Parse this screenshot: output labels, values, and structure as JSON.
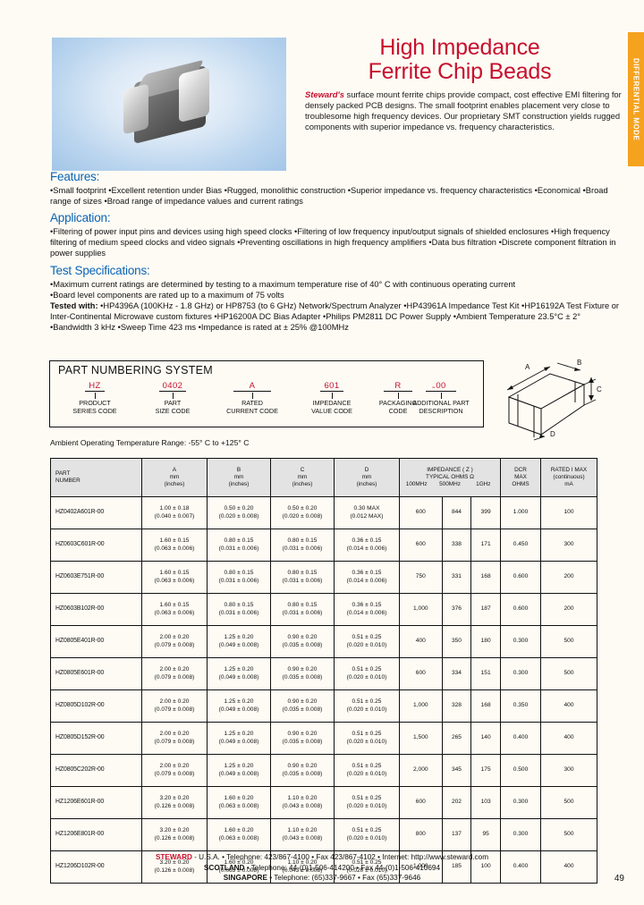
{
  "side_tab": {
    "label": "DIFFERENTIAL MODE",
    "color": "#f5a21e"
  },
  "header": {
    "title_line1": "High Impedance",
    "title_line2": "Ferrite Chip Beads",
    "title_color": "#c8102e",
    "brand": "Steward's",
    "intro": " surface mount ferrite chips provide compact, cost effective EMI filtering for densely packed PCB designs. The small footprint enables placement very close to troublesome high frequency devices. Our proprietary SMT construction yields rugged components with superior impedance vs. frequency characteristics."
  },
  "sections": {
    "features_heading": "Features:",
    "features_text": "•Small footprint  •Excellent retention under Bias  •Rugged, monolithic construction  •Superior impedance vs. frequency characteristics •Economical  •Broad range of sizes  •Broad range of impedance values and current ratings",
    "application_heading": "Application:",
    "application_text": "•Filtering of power input pins and devices using high speed clocks   •Filtering of low frequency input/output signals of shielded enclosures   •High frequency filtering of medium speed clocks and video signals  •Preventing oscillations in high frequency amplifiers •Data bus filtration  •Discrete component filtration in power supplies",
    "test_heading": "Test  Specifications:",
    "test_line1": "•Maximum current ratings are determined by testing to a maximum temperature rise of 40° C with continuous operating current",
    "test_line2": "•Board level components are rated up to a maximum of 75 volts",
    "test_tested_label": "Tested with:",
    "test_line3": " •HP4396A (100KHz - 1.8 GHz) or HP8753 (to 6 GHz) Network/Spectrum Analyzer •HP43961A Impedance Test Kit •HP16192A Test Fixture or Inter-Continental Microwave custom fixtures  •HP16200A DC Bias Adapter  •Philips PM2811 DC Power Supply  •Ambient Temperature 23.5°C ± 2°  •Bandwidth 3 kHz  •Sweep Time 423 ms  •Impedance is rated at ± 25% @100MHz"
  },
  "part_numbering": {
    "title": "PART NUMBERING SYSTEM",
    "separator": "-",
    "fields": [
      {
        "code": "HZ",
        "label_line1": "PRODUCT",
        "label_line2": "SERIES CODE",
        "red": true
      },
      {
        "code": "0402",
        "label_line1": "PART",
        "label_line2": "SIZE CODE",
        "red": true
      },
      {
        "code": "A",
        "label_line1": "RATED",
        "label_line2": "CURRENT CODE",
        "red": true
      },
      {
        "code": "601",
        "label_line1": "IMPEDANCE",
        "label_line2": "VALUE CODE",
        "red": true
      },
      {
        "code": "R",
        "label_line1": "PACKAGING",
        "label_line2": "CODE",
        "red": true
      },
      {
        "code": "00",
        "label_line1": "ADDITIONAL PART",
        "label_line2": "DESCRIPTION",
        "red": true
      }
    ]
  },
  "drawing": {
    "labels": [
      "A",
      "B",
      "C",
      "D"
    ]
  },
  "ambient_note": "Ambient Operating Temperature Range: -55° C to +125° C",
  "table": {
    "headers": {
      "part_number_l1": "PART",
      "part_number_l2": "NUMBER",
      "a_l1": "A",
      "a_l2": "mm",
      "a_l3": "(inches)",
      "b_l1": "B",
      "b_l2": "mm",
      "b_l3": "(inches)",
      "c_l1": "C",
      "c_l2": "mm",
      "c_l3": "(inches)",
      "d_l1": "D",
      "d_l2": "mm",
      "d_l3": "(inches)",
      "imp_l1": "IMPEDANCE ( Z )",
      "imp_l2": "TYPICAL  OHMS Ω",
      "imp_f1": "100MHz",
      "imp_f2": "500MHz",
      "imp_f3": "1GHz",
      "dcr_l1": "DCR",
      "dcr_l2": "MAX",
      "dcr_l3": "OHMS",
      "imax_l1": "RATED I MAX",
      "imax_l2": "(continuous)",
      "imax_l3": "mA"
    },
    "rows": [
      {
        "pn": "HZ0402A601R-00",
        "a_mm": "1.00 ± 0.18",
        "a_in": "(0.040 ± 0.007)",
        "b_mm": "0.50 ± 0.20",
        "b_in": "(0.020 ± 0.008)",
        "c_mm": "0.50 ± 0.20",
        "c_in": "(0.020 ± 0.008)",
        "d_mm": "0.30 MAX",
        "d_in": "(0.012 MAX)",
        "z100": "600",
        "z500": "844",
        "z1g": "399",
        "dcr": "1.000",
        "imax": "100"
      },
      {
        "pn": "HZ0603C601R-00",
        "a_mm": "1.60 ± 0.15",
        "a_in": "(0.063 ± 0.006)",
        "b_mm": "0.80 ± 0.15",
        "b_in": "(0.031 ± 0.006)",
        "c_mm": "0.80 ± 0.15",
        "c_in": "(0.031 ± 0.006)",
        "d_mm": "0.36 ± 0.15",
        "d_in": "(0.014 ± 0.006)",
        "z100": "600",
        "z500": "338",
        "z1g": "171",
        "dcr": "0.450",
        "imax": "300"
      },
      {
        "pn": "HZ0603E751R-00",
        "a_mm": "1.60 ± 0.15",
        "a_in": "(0.063 ± 0.006)",
        "b_mm": "0.80 ± 0.15",
        "b_in": "(0.031 ± 0.006)",
        "c_mm": "0.80 ± 0.15",
        "c_in": "(0.031 ± 0.006)",
        "d_mm": "0.36 ± 0.15",
        "d_in": "(0.014 ± 0.006)",
        "z100": "750",
        "z500": "331",
        "z1g": "168",
        "dcr": "0.600",
        "imax": "200"
      },
      {
        "pn": "HZ0603B102R-00",
        "a_mm": "1.60 ± 0.15",
        "a_in": "(0.063 ± 0.006)",
        "b_mm": "0.80 ± 0.15",
        "b_in": "(0.031 ± 0.006)",
        "c_mm": "0.80 ± 0.15",
        "c_in": "(0.031 ± 0.006)",
        "d_mm": "0.36 ± 0.15",
        "d_in": "(0.014 ± 0.006)",
        "z100": "1,000",
        "z500": "376",
        "z1g": "187",
        "dcr": "0.600",
        "imax": "200"
      },
      {
        "pn": "HZ0805E401R-00",
        "a_mm": "2.00 ± 0.20",
        "a_in": "(0.079 ± 0.008)",
        "b_mm": "1.25 ± 0.20",
        "b_in": "(0.049 ± 0.008)",
        "c_mm": "0.90 ± 0.20",
        "c_in": "(0.035 ± 0.008)",
        "d_mm": "0.51 ± 0.25",
        "d_in": "(0.020 ± 0.010)",
        "z100": "400",
        "z500": "350",
        "z1g": "180",
        "dcr": "0.300",
        "imax": "500"
      },
      {
        "pn": "HZ0805E601R-00",
        "a_mm": "2.00 ± 0.20",
        "a_in": "(0.079 ± 0.008)",
        "b_mm": "1.25 ± 0.20",
        "b_in": "(0.049 ± 0.008)",
        "c_mm": "0.90 ± 0.20",
        "c_in": "(0.035 ± 0.008)",
        "d_mm": "0.51 ± 0.25",
        "d_in": "(0.020 ± 0.010)",
        "z100": "600",
        "z500": "334",
        "z1g": "151",
        "dcr": "0.300",
        "imax": "500"
      },
      {
        "pn": "HZ0805D102R-00",
        "a_mm": "2.00 ± 0.20",
        "a_in": "(0.079 ± 0.008)",
        "b_mm": "1.25 ± 0.20",
        "b_in": "(0.049 ± 0.008)",
        "c_mm": "0.90 ± 0.20",
        "c_in": "(0.035 ± 0.008)",
        "d_mm": "0.51 ± 0.25",
        "d_in": "(0.020 ± 0.010)",
        "z100": "1,000",
        "z500": "328",
        "z1g": "168",
        "dcr": "0.350",
        "imax": "400"
      },
      {
        "pn": "HZ0805D152R-00",
        "a_mm": "2.00 ± 0.20",
        "a_in": "(0.079 ± 0.008)",
        "b_mm": "1.25 ± 0.20",
        "b_in": "(0.049 ± 0.008)",
        "c_mm": "0.90 ± 0.20",
        "c_in": "(0.035 ± 0.008)",
        "d_mm": "0.51 ± 0.25",
        "d_in": "(0.020 ± 0.010)",
        "z100": "1,500",
        "z500": "265",
        "z1g": "140",
        "dcr": "0.400",
        "imax": "400"
      },
      {
        "pn": "HZ0805C202R-00",
        "a_mm": "2.00 ± 0.20",
        "a_in": "(0.079 ± 0.008)",
        "b_mm": "1.25 ± 0.20",
        "b_in": "(0.049 ± 0.008)",
        "c_mm": "0.90 ± 0.20",
        "c_in": "(0.035 ± 0.008)",
        "d_mm": "0.51 ± 0.25",
        "d_in": "(0.020 ± 0.010)",
        "z100": "2,000",
        "z500": "345",
        "z1g": "175",
        "dcr": "0.500",
        "imax": "300"
      },
      {
        "pn": "HZ1206E601R-00",
        "a_mm": "3.20 ± 0.20",
        "a_in": "(0.126 ± 0.008)",
        "b_mm": "1.60 ± 0.20",
        "b_in": "(0.063 ± 0.008)",
        "c_mm": "1.10 ± 0.20",
        "c_in": "(0.043 ± 0.008)",
        "d_mm": "0.51 ± 0.25",
        "d_in": "(0.020 ± 0.010)",
        "z100": "600",
        "z500": "202",
        "z1g": "103",
        "dcr": "0.300",
        "imax": "500"
      },
      {
        "pn": "HZ1206E801R-00",
        "a_mm": "3.20 ± 0.20",
        "a_in": "(0.126 ± 0.008)",
        "b_mm": "1.60 ± 0.20",
        "b_in": "(0.063 ± 0.008)",
        "c_mm": "1.10 ± 0.20",
        "c_in": "(0.043 ± 0.008)",
        "d_mm": "0.51 ± 0.25",
        "d_in": "(0.020 ± 0.010)",
        "z100": "800",
        "z500": "137",
        "z1g": "95",
        "dcr": "0.300",
        "imax": "500"
      },
      {
        "pn": "HZ1206D102R-00",
        "a_mm": "3.20 ± 0.20",
        "a_in": "(0.126 ± 0.008)",
        "b_mm": "1.60 ± 0.20",
        "b_in": "(0.063 ± 0.008)",
        "c_mm": "1.10 ± 0.20",
        "c_in": "(0.043 ± 0.008)",
        "d_mm": "0.51 ± 0.25",
        "d_in": "(0.020 ± 0.010)",
        "z100": "1,000",
        "z500": "185",
        "z1g": "100",
        "dcr": "0.400",
        "imax": "400"
      }
    ]
  },
  "footer": {
    "company": "STEWARD",
    "usa": " - U.S.A. • Telephone: 423/867-4100 • Fax 423/867-4102 • Internet: http://www.steward.com",
    "scotland_label": "SCOTLAND",
    "scotland": " • Telephone: 44-(0)1-506-414200 • Fax 44-(0)1-506-410694",
    "singapore_label": "SINGAPORE",
    "singapore": " • Telephone: (65)337-9667 • Fax (65)337-9646",
    "page_number": "49"
  }
}
